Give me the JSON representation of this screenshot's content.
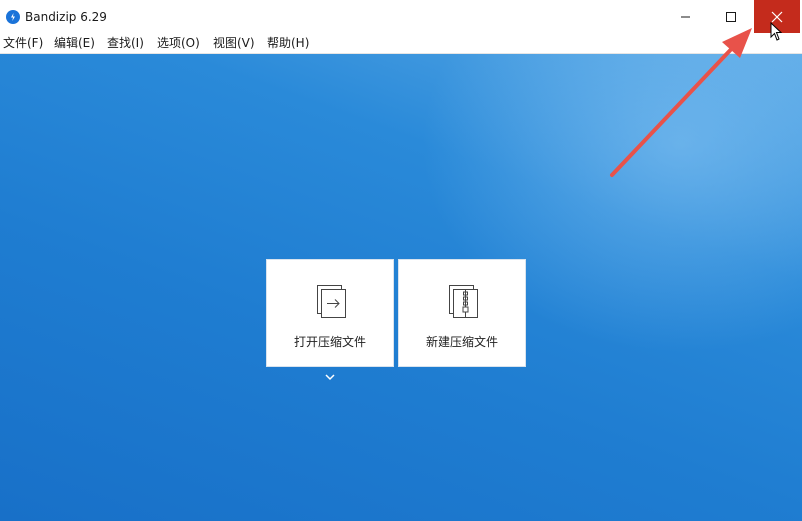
{
  "window": {
    "title": "Bandizip 6.29",
    "icon": "bandizip-logo-icon"
  },
  "controls": {
    "minimize_icon": "minimize-icon",
    "maximize_icon": "maximize-icon",
    "close_icon": "close-icon",
    "close_hover_color": "#c42b1c"
  },
  "menubar": {
    "items": [
      {
        "label": "文件(F)"
      },
      {
        "label": "编辑(E)"
      },
      {
        "label": "查找(I)"
      },
      {
        "label": "选项(O)"
      },
      {
        "label": "视图(V)"
      },
      {
        "label": "帮助(H)"
      }
    ]
  },
  "main": {
    "background_color": "#1f7dd1",
    "tiles": [
      {
        "label": "打开压缩文件",
        "icon": "open-archive-icon"
      },
      {
        "label": "新建压缩文件",
        "icon": "new-archive-icon"
      }
    ],
    "dropdown_icon": "chevron-down-icon"
  },
  "annotation": {
    "arrow_color": "#e8524a"
  }
}
